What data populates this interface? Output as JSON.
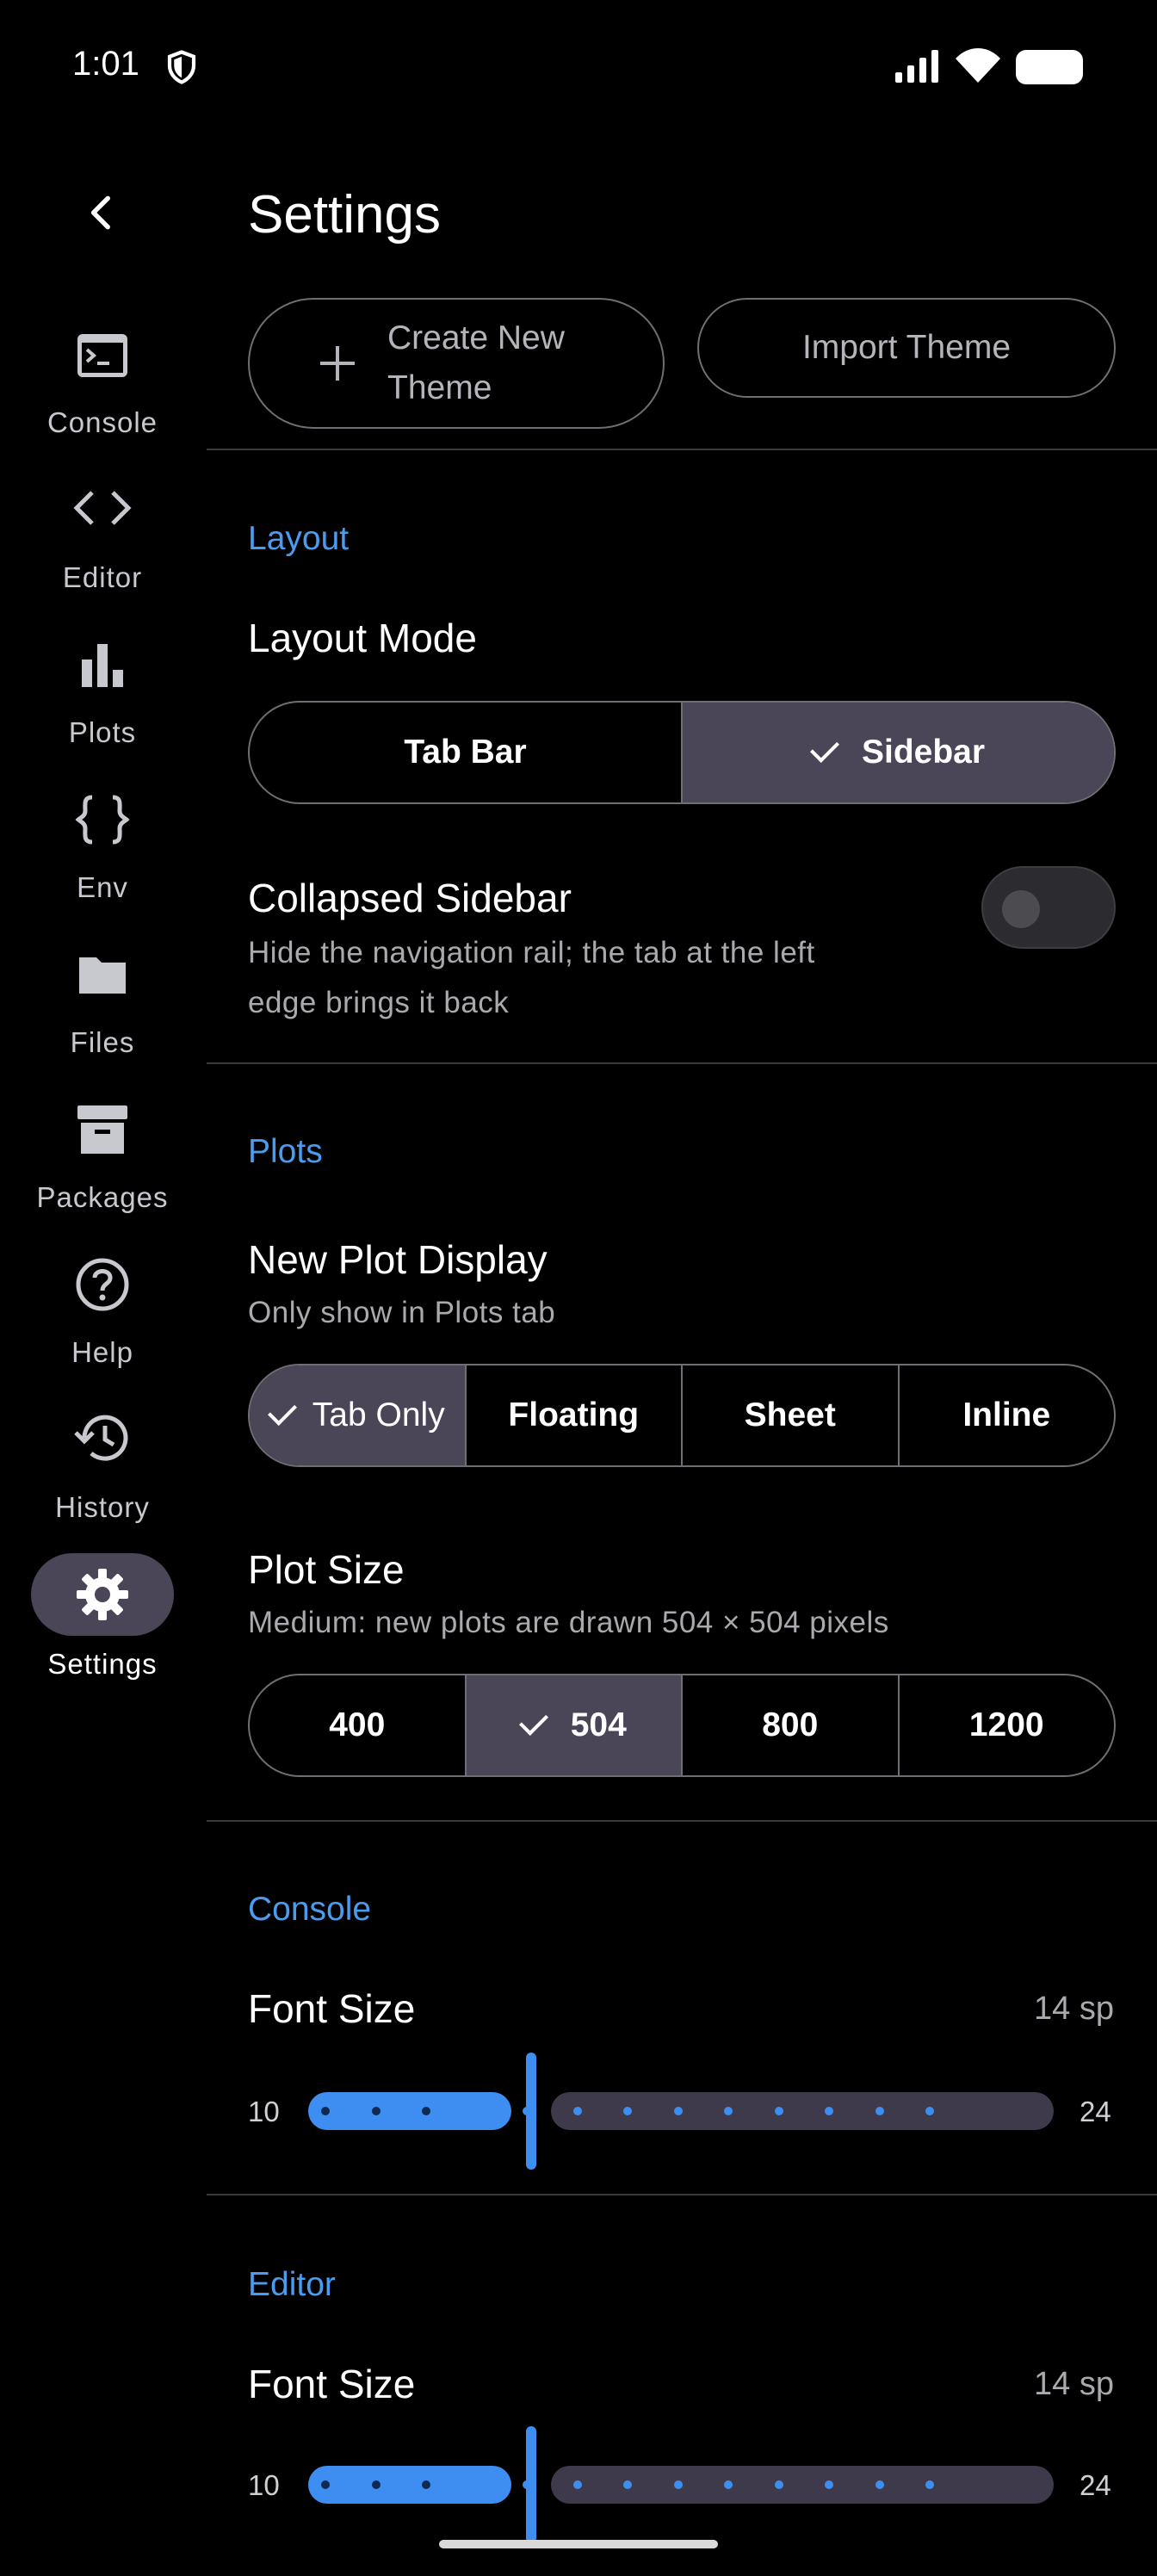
{
  "status_bar": {
    "time": "1:01"
  },
  "header": {
    "title": "Settings"
  },
  "rail": {
    "items": [
      {
        "label": "Console",
        "icon": "console-icon"
      },
      {
        "label": "Editor",
        "icon": "code-icon"
      },
      {
        "label": "Plots",
        "icon": "bar-chart-icon"
      },
      {
        "label": "Env",
        "icon": "braces-icon"
      },
      {
        "label": "Files",
        "icon": "folder-icon"
      },
      {
        "label": "Packages",
        "icon": "archive-icon"
      },
      {
        "label": "Help",
        "icon": "help-icon"
      },
      {
        "label": "History",
        "icon": "history-icon"
      },
      {
        "label": "Settings",
        "icon": "gear-icon",
        "selected": true
      }
    ]
  },
  "theme": {
    "create_label_line1": "Create New",
    "create_label_line2": "Theme",
    "import_label": "Import Theme"
  },
  "layout": {
    "section": "Layout",
    "mode_title": "Layout Mode",
    "mode_options": [
      "Tab Bar",
      "Sidebar"
    ],
    "mode_selected": "Sidebar",
    "collapsed_title": "Collapsed Sidebar",
    "collapsed_desc_line1": "Hide the navigation rail; the tab at the left",
    "collapsed_desc_line2": "edge brings it back",
    "collapsed_on": false
  },
  "plots": {
    "section": "Plots",
    "display_title": "New Plot Display",
    "display_subtitle": "Only show in Plots tab",
    "display_options": [
      "Tab Only",
      "Floating",
      "Sheet",
      "Inline"
    ],
    "display_selected": "Tab Only",
    "size_title": "Plot Size",
    "size_subtitle": "Medium: new plots are drawn 504 × 504 pixels",
    "size_options": [
      "400",
      "504",
      "800",
      "1200"
    ],
    "size_selected": "504"
  },
  "console": {
    "section": "Console",
    "font_title": "Font Size",
    "font_value": "14 sp",
    "min": "10",
    "max": "24",
    "value": 14
  },
  "editor": {
    "section": "Editor",
    "font_title": "Font Size",
    "font_value": "14 sp",
    "min": "10",
    "max": "24",
    "value": 14
  },
  "colors": {
    "accent": "#4a9cf0",
    "selected_bg": "#4a4557",
    "slider_active": "#3d8ef0"
  }
}
